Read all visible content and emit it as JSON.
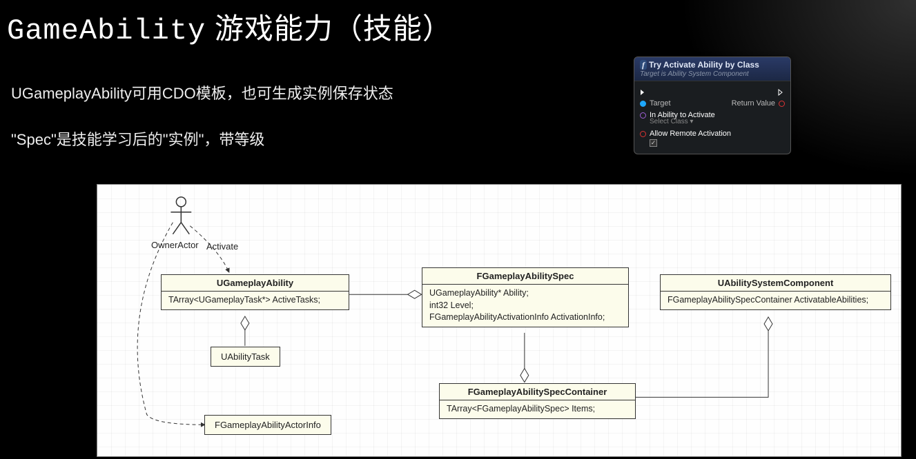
{
  "title": {
    "mono": "GameAbility",
    "rest": " 游戏能力（技能）"
  },
  "bullets": {
    "b1": "UGameplayAbility可用CDO模板，也可生成实例保存状态",
    "b2": "\"Spec\"是技能学习后的\"实例\"，带等级"
  },
  "bp": {
    "title": "Try Activate Ability by Class",
    "subtitle": "Target is Ability System Component",
    "target": "Target",
    "return": "Return Value",
    "inAbility": "In Ability to Activate",
    "selectClass": "Select Class ▾",
    "allowRemote": "Allow Remote Activation",
    "check": "✓"
  },
  "diagram": {
    "ownerActor": "OwnerActor",
    "activate": "Activate",
    "ugameplayAbility": {
      "name": "UGameplayAbility",
      "field": "TArray<UGameplayTask*> ActiveTasks;"
    },
    "uabilityTask": "UAbilityTask",
    "actorInfo": "FGameplayAbilityActorInfo",
    "spec": {
      "name": "FGameplayAbilitySpec",
      "f1": "UGameplayAbility* Ability;",
      "f2": "int32 Level;",
      "f3": "FGameplayAbilityActivationInfo ActivationInfo;"
    },
    "specContainer": {
      "name": "FGameplayAbilitySpecContainer",
      "field": "TArray<FGameplayAbilitySpec> Items;"
    },
    "asc": {
      "name": "UAbilitySystemComponent",
      "field": "FGameplayAbilitySpecContainer ActivatableAbilities;"
    }
  }
}
